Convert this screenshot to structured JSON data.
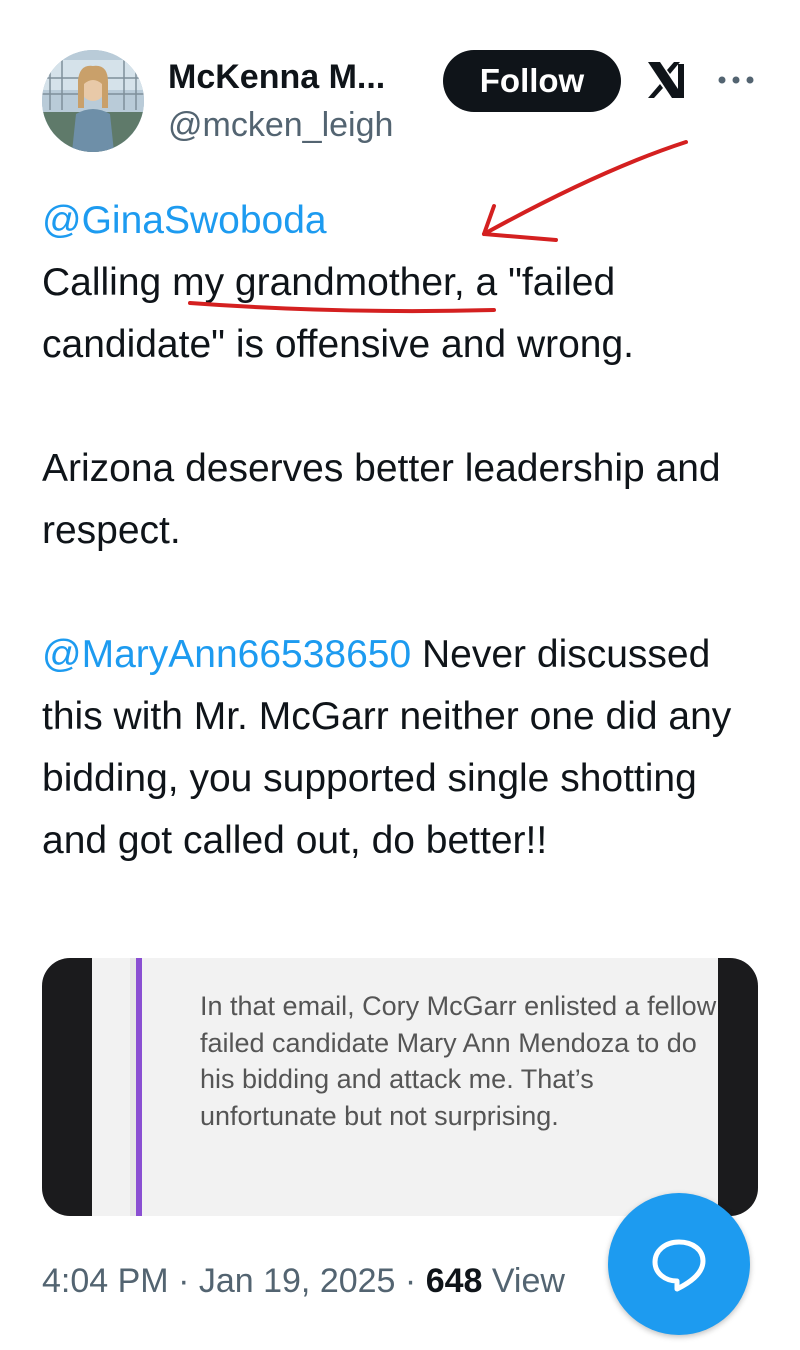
{
  "author": {
    "display_name": "McKenna M...",
    "handle": "@mcken_leigh",
    "avatar": "profile-photo"
  },
  "actions": {
    "follow_label": "Follow",
    "platform_icon": "x-logo-icon",
    "more_icon": "more-options-icon"
  },
  "tweet": {
    "mention_1": "@GinaSwoboda",
    "line_1_pre": "Calling ",
    "line_1_underlined": "my grandmother,",
    "line_1_post": " a \"failed",
    "line_2": "candidate\" is offensive and wrong.",
    "paragraph_2": "Arizona deserves better leadership and respect.",
    "mention_2": "@MaryAnn66538650",
    "paragraph_3_rest": " Never discussed this with Mr. McGarr neither one did any bidding, you supported single shotting and got called out, do better!!"
  },
  "quoted_image": {
    "text": "In that email, Cory McGarr enlisted a fellow failed candidate Mary Ann Mendoza to do his bidding and attack me. That’s unfortunate but not surprising."
  },
  "meta": {
    "time": "4:04 PM",
    "separator": " · ",
    "date": "Jan 19, 2025",
    "views_count": "648",
    "views_label": " View"
  },
  "fab": {
    "icon": "reply-bubble-icon"
  },
  "colors": {
    "accent": "#1d9bf0",
    "annotation": "#d42020",
    "text": "#0f1419",
    "secondary": "#536471"
  }
}
